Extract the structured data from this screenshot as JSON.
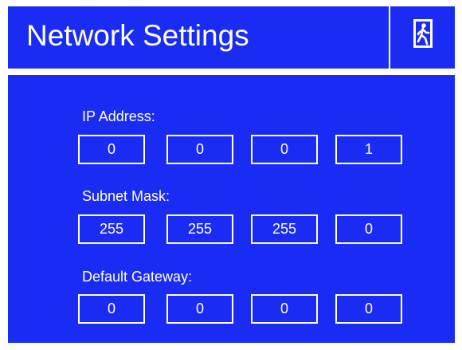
{
  "header": {
    "title": "Network Settings",
    "exit_icon": "running-man-exit-icon"
  },
  "colors": {
    "background": "#ffffff",
    "panel": "#1a2cf3",
    "text": "#ffffff",
    "border": "#ffffff"
  },
  "ip_address": {
    "label": "IP Address:",
    "octets": [
      "0",
      "0",
      "0",
      "1"
    ]
  },
  "subnet_mask": {
    "label": "Subnet Mask:",
    "octets": [
      "255",
      "255",
      "255",
      "0"
    ]
  },
  "default_gateway": {
    "label": "Default Gateway:",
    "octets": [
      "0",
      "0",
      "0",
      "0"
    ]
  }
}
